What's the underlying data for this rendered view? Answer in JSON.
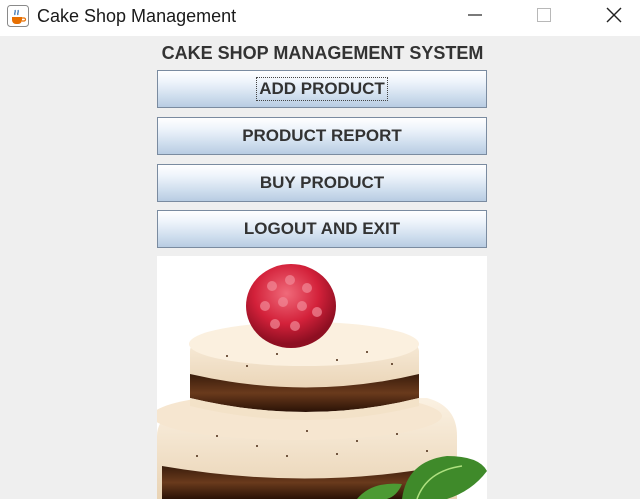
{
  "window": {
    "title": "Cake Shop Management",
    "icon": "java-cup-icon",
    "controls": [
      "minimize-icon",
      "maximize-icon",
      "close-icon"
    ]
  },
  "main": {
    "heading": "CAKE SHOP MANAGEMENT SYSTEM",
    "buttons": {
      "add_product": "ADD PRODUCT",
      "product_report": "PRODUCT REPORT",
      "buy_product": "BUY PRODUCT",
      "logout_exit": "LOGOUT AND EXIT"
    },
    "image": "cake-with-raspberry-image"
  },
  "colors": {
    "background": "#efefef",
    "button_top": "#ffffff",
    "button_bottom": "#b8cce2",
    "button_border": "#7a8ba0",
    "text": "#333333"
  }
}
